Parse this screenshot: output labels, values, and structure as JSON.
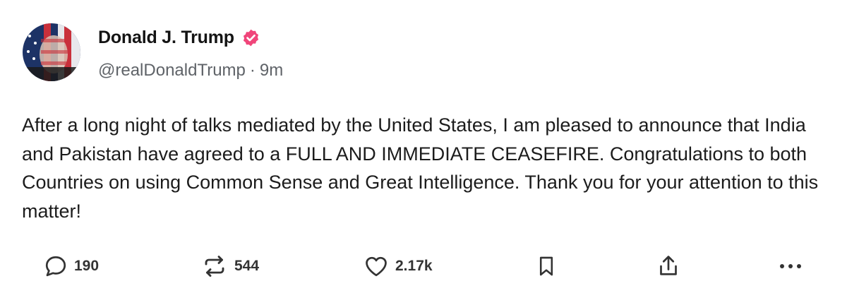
{
  "author": {
    "display_name": "Donald J. Trump",
    "verified": true,
    "handle": "@realDonaldTrump",
    "separator": "·",
    "time_ago": "9m"
  },
  "post": {
    "text": "After a long night of talks mediated by the United States, I am pleased to announce that India and Pakistan have agreed to a FULL AND IMMEDIATE CEASEFIRE. Congratulations to both Countries on using Common Sense and Great Intelligence. Thank you for your attention to this matter!"
  },
  "actions": {
    "reply": {
      "icon": "reply-icon",
      "count": "190"
    },
    "repost": {
      "icon": "repost-icon",
      "count": "544"
    },
    "like": {
      "icon": "heart-icon",
      "count": "2.17k"
    },
    "bookmark": {
      "icon": "bookmark-icon"
    },
    "share": {
      "icon": "share-icon"
    },
    "more": {
      "icon": "more-icon"
    }
  },
  "colors": {
    "verified_badge": "#f0457a",
    "text": "#1c1c1c",
    "muted": "#5f6368"
  }
}
